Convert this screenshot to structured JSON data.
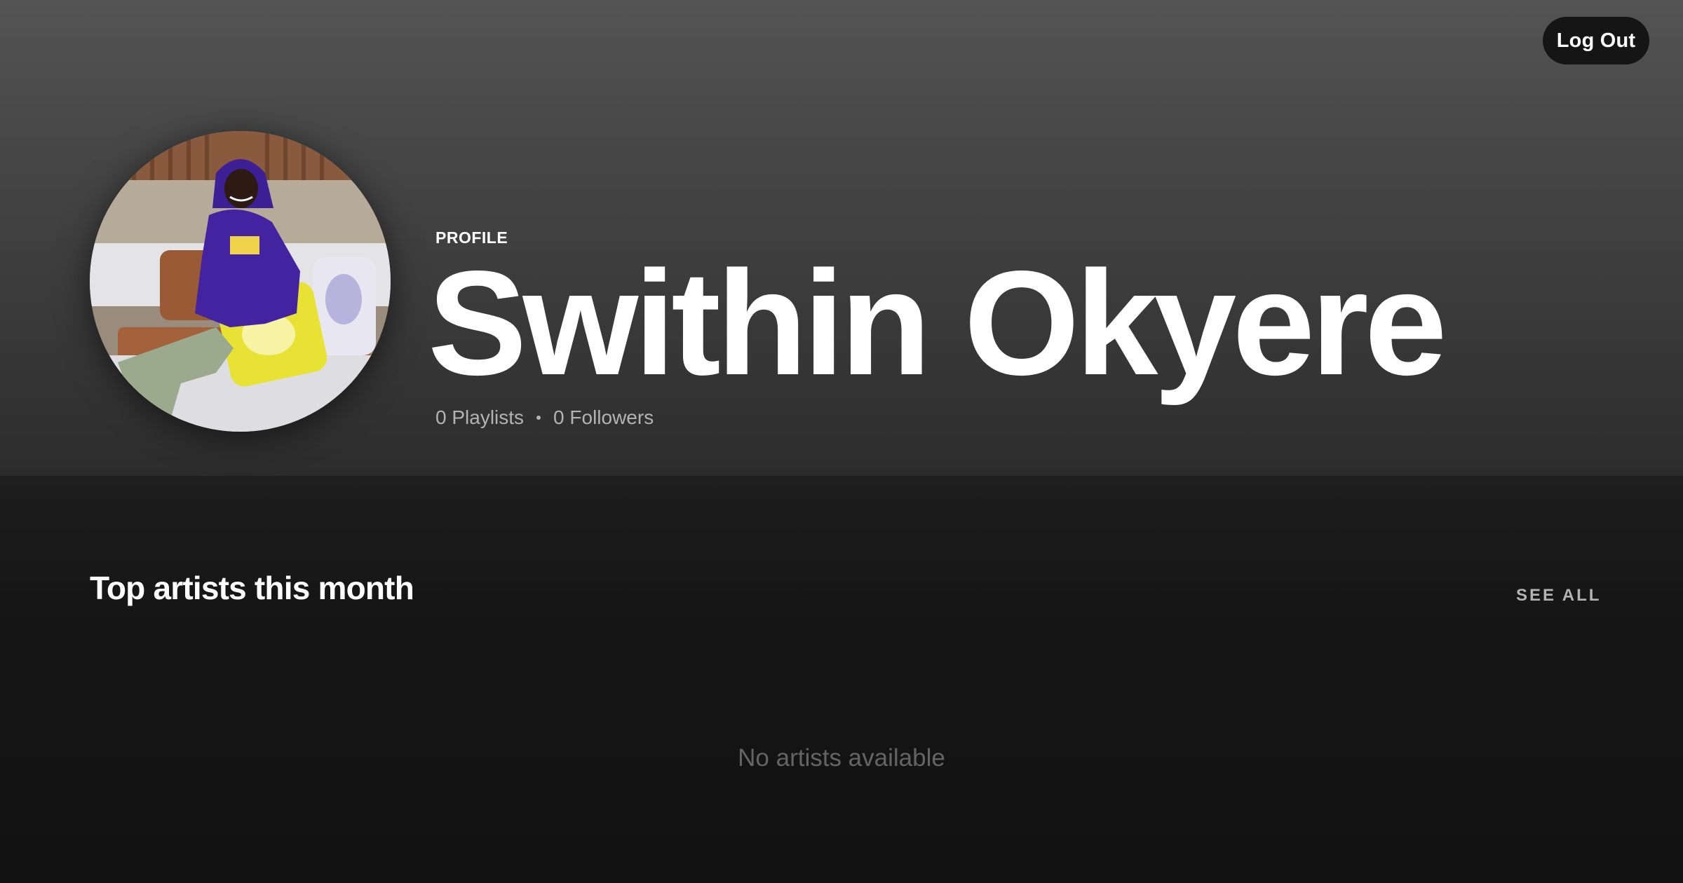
{
  "header": {
    "logout_label": "Log Out"
  },
  "profile": {
    "type_label": "PROFILE",
    "name": "Swithin Okyere",
    "playlists": "0 Playlists",
    "followers": "0 Followers"
  },
  "top_artists": {
    "title": "Top artists this month",
    "see_all_label": "SEE ALL",
    "empty_message": "No artists available"
  },
  "colors": {
    "hero_top": "#545454",
    "hero_bottom": "#2c2c2c",
    "background": "#121212",
    "text_primary": "#ffffff",
    "text_secondary": "#b3b3b3",
    "text_muted": "#646464",
    "logout_button_bg": "#151515"
  }
}
